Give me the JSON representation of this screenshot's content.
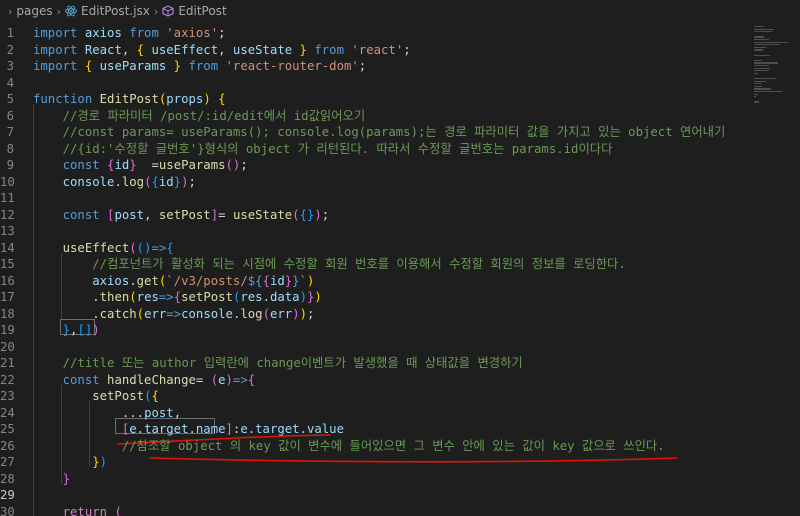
{
  "breadcrumb": {
    "folder": "pages",
    "file": "EditPost.jsx",
    "symbol": "EditPost"
  },
  "editor": {
    "lines": [
      {
        "n": "1",
        "tokens": [
          [
            "kw",
            "import"
          ],
          [
            "",
            ""
          ],
          [
            "var",
            " axios"
          ],
          [
            "kw",
            " from"
          ],
          [
            "str",
            " 'axios'"
          ],
          [
            "",
            ";"
          ]
        ]
      },
      {
        "n": "2",
        "tokens": [
          [
            "kw",
            "import"
          ],
          [
            "var",
            " React"
          ],
          [
            "",
            ", "
          ],
          [
            "br1",
            "{"
          ],
          [
            "var",
            " useEffect"
          ],
          [
            "",
            ", "
          ],
          [
            "var",
            "useState"
          ],
          [
            "br1",
            " }"
          ],
          [
            "kw",
            " from"
          ],
          [
            "str",
            " 'react'"
          ],
          [
            "",
            ";"
          ]
        ]
      },
      {
        "n": "3",
        "tokens": [
          [
            "kw",
            "import"
          ],
          [
            "br1",
            " {"
          ],
          [
            "var",
            " useParams"
          ],
          [
            "br1",
            " }"
          ],
          [
            "kw",
            " from"
          ],
          [
            "str",
            " 'react-router-dom'"
          ],
          [
            "",
            ";"
          ]
        ]
      },
      {
        "n": "4",
        "tokens": []
      },
      {
        "n": "5",
        "tokens": [
          [
            "kw",
            "function"
          ],
          [
            "fn",
            " EditPost"
          ],
          [
            "br1",
            "("
          ],
          [
            "var",
            "props"
          ],
          [
            "br1",
            ")"
          ],
          [
            "br1",
            " {"
          ]
        ]
      },
      {
        "n": "6",
        "tokens": [
          [
            "cm",
            "    //경로 파라미터 /post/:id/edit에서 id값읽어오기"
          ]
        ]
      },
      {
        "n": "7",
        "tokens": [
          [
            "cm",
            "    //const params= useParams(); console.log(params);는 경로 파라미터 값을 가지고 있는 object 연어내기"
          ]
        ]
      },
      {
        "n": "8",
        "tokens": [
          [
            "cm",
            "    //{id:'수정할 글번호'}형식의 object 가 리턴된다. 따라서 수정할 글번호는 params.id이다다"
          ]
        ]
      },
      {
        "n": "9",
        "tokens": [
          [
            "kw",
            "    const"
          ],
          [
            "br2",
            " {"
          ],
          [
            "var",
            "id"
          ],
          [
            "br2",
            "}"
          ],
          [
            "",
            "  ="
          ],
          [
            "fn",
            "useParams"
          ],
          [
            "br2",
            "()"
          ],
          [
            "",
            ";"
          ]
        ]
      },
      {
        "n": "10",
        "tokens": [
          [
            "var",
            "    console"
          ],
          [
            "",
            "."
          ],
          [
            "fn",
            "log"
          ],
          [
            "br2",
            "("
          ],
          [
            "br3",
            "{"
          ],
          [
            "var",
            "id"
          ],
          [
            "br3",
            "}"
          ],
          [
            "br2",
            ")"
          ],
          [
            "",
            ";"
          ]
        ]
      },
      {
        "n": "11",
        "tokens": []
      },
      {
        "n": "12",
        "tokens": [
          [
            "kw",
            "    const"
          ],
          [
            "br2",
            " ["
          ],
          [
            "var",
            "post"
          ],
          [
            "",
            ", "
          ],
          [
            "fn",
            "setPost"
          ],
          [
            "br2",
            "]"
          ],
          [
            "",
            "= "
          ],
          [
            "fn",
            "useState"
          ],
          [
            "br2",
            "("
          ],
          [
            "br3",
            "{}"
          ],
          [
            "br2",
            ")"
          ],
          [
            "",
            ";"
          ]
        ]
      },
      {
        "n": "13",
        "tokens": []
      },
      {
        "n": "14",
        "tokens": [
          [
            "fn",
            "    useEffect"
          ],
          [
            "br2",
            "("
          ],
          [
            "br3",
            "()"
          ],
          [
            "kw",
            "=>"
          ],
          [
            "br3",
            "{"
          ]
        ]
      },
      {
        "n": "15",
        "tokens": [
          [
            "cm",
            "        //컴포넌트가 활성화 되는 시점에 수정할 회원 번호를 이용해서 수정할 회원의 정보를 로딩한다."
          ]
        ]
      },
      {
        "n": "16",
        "tokens": [
          [
            "var",
            "        axios"
          ],
          [
            "",
            "."
          ],
          [
            "fn",
            "get"
          ],
          [
            "br1",
            "("
          ],
          [
            "tpl",
            "`/v3/posts/"
          ],
          [
            "kw",
            "${"
          ],
          [
            "br2",
            "{"
          ],
          [
            "var",
            "id"
          ],
          [
            "br2",
            "}"
          ],
          [
            "kw",
            "}"
          ],
          [
            "tpl",
            "`"
          ],
          [
            "br1",
            ")"
          ]
        ]
      },
      {
        "n": "17",
        "tokens": [
          [
            "",
            "        ."
          ],
          [
            "fn",
            "then"
          ],
          [
            "br1",
            "("
          ],
          [
            "var",
            "res"
          ],
          [
            "kw",
            "=>"
          ],
          [
            "br2",
            "{"
          ],
          [
            "fn",
            "setPost"
          ],
          [
            "br3",
            "("
          ],
          [
            "var",
            "res"
          ],
          [
            "",
            "."
          ],
          [
            "var",
            "data"
          ],
          [
            "br3",
            ")"
          ],
          [
            "br2",
            "}"
          ],
          [
            "br1",
            ")"
          ]
        ]
      },
      {
        "n": "18",
        "tokens": [
          [
            "",
            "        ."
          ],
          [
            "fn",
            "catch"
          ],
          [
            "br1",
            "("
          ],
          [
            "var",
            "err"
          ],
          [
            "kw",
            "=>"
          ],
          [
            "var",
            "console"
          ],
          [
            "",
            "."
          ],
          [
            "fn",
            "log"
          ],
          [
            "br2",
            "("
          ],
          [
            "var",
            "err"
          ],
          [
            "br2",
            ")"
          ],
          [
            "br1",
            ")"
          ],
          [
            "",
            ";"
          ]
        ]
      },
      {
        "n": "19",
        "tokens": [
          [
            "br3",
            "    }"
          ],
          [
            "",
            ","
          ],
          [
            "br3",
            "[]"
          ],
          [
            "br2",
            ")"
          ]
        ]
      },
      {
        "n": "20",
        "tokens": []
      },
      {
        "n": "21",
        "tokens": [
          [
            "cm",
            "    //title 또는 author 입력란에 change이벤트가 발생했을 때 상태값을 변경하기"
          ]
        ]
      },
      {
        "n": "22",
        "tokens": [
          [
            "kw",
            "    const"
          ],
          [
            "fn",
            " handleChange"
          ],
          [
            "",
            "= "
          ],
          [
            "br2",
            "("
          ],
          [
            "var",
            "e"
          ],
          [
            "br2",
            ")"
          ],
          [
            "kw",
            "=>"
          ],
          [
            "br2",
            "{"
          ]
        ]
      },
      {
        "n": "23",
        "tokens": [
          [
            "fn",
            "        setPost"
          ],
          [
            "br3",
            "("
          ],
          [
            "br1",
            "{"
          ]
        ]
      },
      {
        "n": "24",
        "tokens": [
          [
            "",
            "            ..."
          ],
          [
            "var",
            "post"
          ],
          [
            "",
            ","
          ]
        ]
      },
      {
        "n": "25",
        "tokens": [
          [
            "br2",
            "            ["
          ],
          [
            "var",
            "e"
          ],
          [
            "",
            "."
          ],
          [
            "var",
            "target"
          ],
          [
            "",
            "."
          ],
          [
            "var",
            "name"
          ],
          [
            "br2",
            "]"
          ],
          [
            "",
            ":"
          ],
          [
            "var",
            "e"
          ],
          [
            "",
            "."
          ],
          [
            "var",
            "target"
          ],
          [
            "",
            "."
          ],
          [
            "var",
            "value"
          ]
        ]
      },
      {
        "n": "26",
        "tokens": [
          [
            "cm",
            "            //참조할 object 의 key 값이 변수에 들어있으면 그 변수 안에 있는 값이 key 값으로 쓰인다."
          ]
        ]
      },
      {
        "n": "27",
        "tokens": [
          [
            "br1",
            "        }"
          ],
          [
            "br3",
            ")"
          ]
        ]
      },
      {
        "n": "28",
        "tokens": [
          [
            "br2",
            "    }"
          ]
        ]
      },
      {
        "n": "29",
        "tokens": []
      },
      {
        "n": "30",
        "tokens": [
          [
            "ctl",
            "    return"
          ],
          [
            "br2",
            " ("
          ]
        ]
      }
    ]
  },
  "colors": {
    "background": "#1e1e1e",
    "keyword": "#569cd6",
    "string": "#ce9178",
    "function": "#dcdcaa",
    "variable": "#9cdcfe",
    "comment": "#6a9955",
    "annotation_red": "#e51400"
  },
  "icons": {
    "react_file": "react-icon",
    "symbol": "symbol-class-icon"
  }
}
